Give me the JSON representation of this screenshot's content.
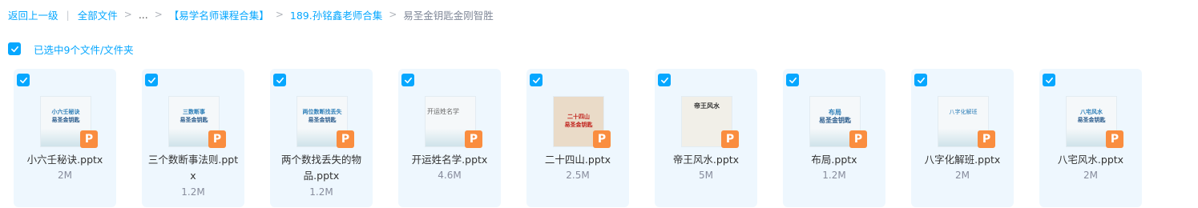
{
  "breadcrumb": {
    "back": "返回上一级",
    "all_files": "全部文件",
    "ellipsis": "...",
    "folder1": "【易学名师课程合集】",
    "folder2": "189.孙铭鑫老师合集",
    "current": "易圣金钥匙金刚智胜"
  },
  "selection": {
    "label": "已选中9个文件/文件夹"
  },
  "files": [
    {
      "name": "小六壬秘诀.pptx",
      "size": "2M",
      "thumb_line1": "小六壬秘诀",
      "thumb_line2": "易圣金钥匙"
    },
    {
      "name": "三个数断事法则.pptx",
      "size": "1.2M",
      "thumb_line1": "三数断事",
      "thumb_line2": "易圣金钥匙"
    },
    {
      "name": "两个数找丢失的物品.pptx",
      "size": "1.2M",
      "thumb_line1": "两位数断找丢失",
      "thumb_line2": "易圣金钥匙"
    },
    {
      "name": "开运姓名学.pptx",
      "size": "4.6M",
      "thumb_line1": "开运姓名学",
      "thumb_line2": ""
    },
    {
      "name": "二十四山.pptx",
      "size": "2.5M",
      "thumb_line1": "二十四山",
      "thumb_line2": "易圣金钥匙"
    },
    {
      "name": "帝王风水.pptx",
      "size": "5M",
      "thumb_line1": "帝王风水",
      "thumb_line2": ""
    },
    {
      "name": "布局.pptx",
      "size": "1.2M",
      "thumb_line1": "布局",
      "thumb_line2": "易圣金钥匙"
    },
    {
      "name": "八字化解班.pptx",
      "size": "2M",
      "thumb_line1": "八字化解班",
      "thumb_line2": ""
    },
    {
      "name": "八宅风水.pptx",
      "size": "2M",
      "thumb_line1": "八宅风水",
      "thumb_line2": "易圣金钥匙"
    }
  ],
  "badge_letter": "P",
  "colors": {
    "accent": "#06a7ff",
    "card_bg": "#eef7fe",
    "ppt_badge": "#fa8d3f"
  }
}
